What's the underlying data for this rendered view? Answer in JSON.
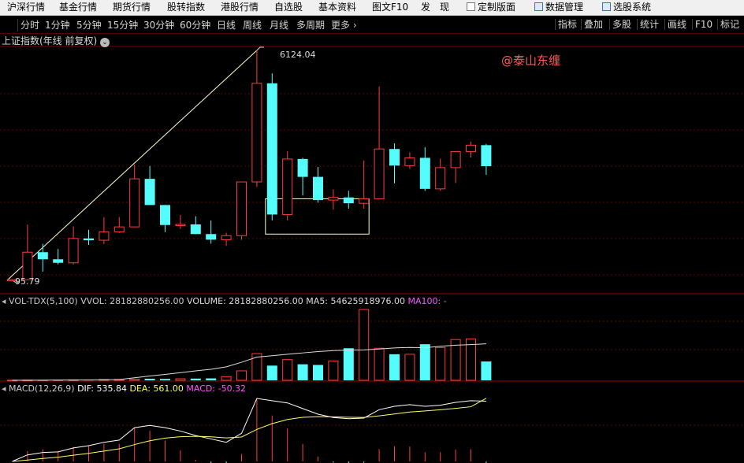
{
  "menu": {
    "items": [
      "沪深行情",
      "基金行情",
      "期货行情",
      "股转指数",
      "港股行情",
      "自选股",
      "基本资料",
      "图文F10",
      "发　现",
      "定制版面",
      "数据管理",
      "选股系统"
    ]
  },
  "periods": {
    "items": [
      "分时",
      "1分钟",
      "5分钟",
      "15分钟",
      "30分钟",
      "60分钟",
      "日线",
      "周线",
      "月线",
      "多周期"
    ],
    "more": "更多",
    "right_buttons": [
      "指标",
      "叠加",
      "多股",
      "统计",
      "画线",
      "F10",
      "标记"
    ]
  },
  "main_chart": {
    "title": "上证指数(年线 前复权)",
    "high_label": "6124.04",
    "low_label": "95.79",
    "watermark": "@泰山东缠",
    "colors": {
      "up": "#ff3b3b",
      "down": "#54fcfc",
      "annotation": "#ffffcc",
      "watermark": "#ff5a5a"
    },
    "candles": [
      {
        "o": 95.79,
        "h": 127.61,
        "l": 95.79,
        "c": 112.5
      },
      {
        "o": 112.5,
        "h": 1558.95,
        "l": 105,
        "c": 833.8
      },
      {
        "o": 833.8,
        "h": 1052.94,
        "l": 325,
        "c": 647.87
      },
      {
        "o": 647.87,
        "h": 917,
        "l": 512,
        "c": 555.29
      },
      {
        "o": 555.29,
        "h": 1510.18,
        "l": 512,
        "c": 1194.1
      },
      {
        "o": 1194.1,
        "h": 1422.98,
        "l": 1025,
        "c": 1146.7
      },
      {
        "o": 1146.7,
        "h": 1756.18,
        "l": 1047.83,
        "c": 1366.58
      },
      {
        "o": 1366.58,
        "h": 1756.06,
        "l": 1339.2,
        "c": 1497.04
      },
      {
        "o": 1497.04,
        "h": 3125,
        "l": 1493.4,
        "c": 2756.7
      },
      {
        "o": 2756.7,
        "h": 3093.7,
        "l": 2312.8,
        "c": 2069.6
      },
      {
        "o": 2069.6,
        "h": 2073.48,
        "l": 1361.21,
        "c": 1545.79
      },
      {
        "o": 1545.79,
        "h": 1807.7,
        "l": 1443.76,
        "c": 1561.95
      },
      {
        "o": 1561.95,
        "h": 1776.0,
        "l": 1305.9,
        "c": 1308.5
      },
      {
        "o": 1308.5,
        "h": 1664.1,
        "l": 1058.0,
        "c": 1161.1
      },
      {
        "o": 1161.1,
        "h": 1345.0,
        "l": 998.2,
        "c": 1266.5
      },
      {
        "o": 1266.5,
        "h": 2218.0,
        "l": 1158.3,
        "c": 2675.5
      },
      {
        "o": 2675.5,
        "h": 6124.04,
        "l": 2541.5,
        "c": 5261.56
      },
      {
        "o": 5261.56,
        "h": 5522.78,
        "l": 1664.9,
        "c": 1820.81
      },
      {
        "o": 1820.81,
        "h": 3478.01,
        "l": 1664.93,
        "c": 3277.14
      },
      {
        "o": 3277.14,
        "h": 3306.75,
        "l": 2319.74,
        "c": 2808.08
      },
      {
        "o": 2808.08,
        "h": 3067.46,
        "l": 2132.63,
        "c": 2199.42
      },
      {
        "o": 2199.42,
        "h": 2478.38,
        "l": 1949.46,
        "c": 2269.13
      },
      {
        "o": 2269.13,
        "h": 2444.8,
        "l": 1974.38,
        "c": 2115.98
      },
      {
        "o": 2115.98,
        "h": 3239.36,
        "l": 1974.38,
        "c": 2234.25
      },
      {
        "o": 2234.25,
        "h": 5178.19,
        "l": 2934.0,
        "c": 3539.18
      },
      {
        "o": 3539.18,
        "h": 3684.57,
        "l": 2638.3,
        "c": 3103.64
      },
      {
        "o": 3103.64,
        "h": 3450.0,
        "l": 3016.0,
        "c": 3307.17
      },
      {
        "o": 3307.17,
        "h": 3587.0,
        "l": 2440.91,
        "c": 2493.9
      },
      {
        "o": 2493.9,
        "h": 3288.45,
        "l": 2440.91,
        "c": 3050.12
      },
      {
        "o": 3050.12,
        "h": 3474.0,
        "l": 2646.8,
        "c": 3473.07
      },
      {
        "o": 3473.07,
        "h": 3731.69,
        "l": 3312.72,
        "c": 3639.78
      },
      {
        "o": 3639.78,
        "h": 3674.4,
        "l": 2863.65,
        "c": 3089.26
      }
    ]
  },
  "vol_panel": {
    "header": {
      "name": "VOL-TDX(5,100)",
      "vvol": "VVOL: 28182880256.00",
      "volume": "VOLUME: 28182880256.00",
      "ma5": "MA5: 54625918976.00",
      "ma100": "MA100: -"
    },
    "colors": {
      "header": "#cccccc",
      "ma5": "#dddddd",
      "ma100": "#ff55ff"
    },
    "ma5_line": [
      0.2,
      0.2,
      0.3,
      0.4,
      0.5,
      0.6,
      0.8,
      1.2,
      3.8,
      6.5,
      8.9,
      11.5,
      14.2,
      16.5,
      20.2,
      27.0,
      34.7,
      36.8,
      39.0,
      41.0,
      43.0,
      44.5,
      45.2,
      45.5,
      46.8,
      48.5,
      49.2,
      48.8,
      51.0,
      52.5,
      53.5,
      54.63
    ],
    "volumes": [
      0.2,
      0.4,
      0.5,
      0.7,
      0.8,
      1.0,
      1.3,
      1.4,
      1.8,
      2.4,
      2.1,
      2.3,
      2.6,
      2.9,
      5.5,
      14.2,
      40.0,
      22.0,
      31.0,
      24.0,
      23.0,
      29.0,
      48.0,
      106.0,
      48.0,
      39.0,
      39.0,
      54.0,
      49.0,
      61.0,
      62.0,
      28.2
    ]
  },
  "macd_panel": {
    "header": {
      "name": "MACD(12,26,9)",
      "dif": "DIF: 535.84",
      "dea": "DEA: 561.00",
      "macd": "MACD: -50.32"
    },
    "colors": {
      "header": "#cccccc",
      "dif": "#ffffff",
      "dea": "#ffff66",
      "macd": "#ff55ff"
    },
    "dif": [
      0,
      58,
      80,
      85,
      120,
      140,
      170,
      190,
      300,
      320,
      300,
      270,
      230,
      200,
      170,
      250,
      560,
      540,
      520,
      470,
      420,
      390,
      380,
      385,
      460,
      490,
      505,
      490,
      500,
      525,
      540,
      535.84
    ],
    "dea": [
      0,
      12,
      26,
      38,
      55,
      72,
      92,
      112,
      150,
      184,
      207,
      220,
      223,
      219,
      209,
      217,
      285,
      336,
      373,
      392,
      398,
      396,
      393,
      391,
      405,
      422,
      439,
      449,
      459,
      472,
      486,
      561.0
    ],
    "macd_bars": [
      0,
      92,
      108,
      95,
      130,
      136,
      156,
      156,
      300,
      272,
      186,
      100,
      14,
      -38,
      -78,
      66,
      550,
      408,
      294,
      156,
      44,
      -12,
      -26,
      -12,
      110,
      136,
      132,
      82,
      82,
      106,
      108,
      -50.32
    ]
  }
}
